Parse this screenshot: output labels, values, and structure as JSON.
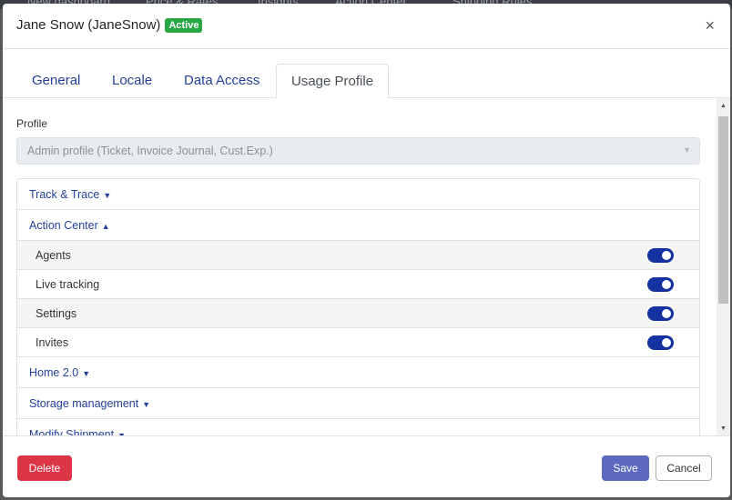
{
  "background_menu": [
    "New dashboard",
    "Price & Rates",
    "Insights",
    "Action Center",
    "Shipping Rules"
  ],
  "modal": {
    "user_name": "Jane Snow (JaneSnow)",
    "status_badge": "Active",
    "close_glyph": "×"
  },
  "tabs": [
    {
      "label": "General",
      "active": false
    },
    {
      "label": "Locale",
      "active": false
    },
    {
      "label": "Data Access",
      "active": false
    },
    {
      "label": "Usage Profile",
      "active": true
    }
  ],
  "profile": {
    "label": "Profile",
    "value": "Admin profile (Ticket, Invoice Journal, Cust.Exp.)",
    "disabled": true
  },
  "sections": {
    "track_trace": {
      "label": "Track & Trace",
      "arrow": "▼"
    },
    "action_center": {
      "label": "Action Center",
      "arrow": "▲"
    },
    "home": {
      "label": "Home 2.0",
      "arrow": "▼"
    },
    "storage": {
      "label": "Storage management",
      "arrow": "▼"
    },
    "modify_shipment": {
      "label": "Modify Shipment",
      "arrow": "▼"
    }
  },
  "action_center_items": [
    {
      "label": "Agents",
      "enabled": true
    },
    {
      "label": "Live tracking",
      "enabled": true
    },
    {
      "label": "Settings",
      "enabled": true
    },
    {
      "label": "Invites",
      "enabled": true
    }
  ],
  "footer": {
    "delete_label": "Delete",
    "save_label": "Save",
    "cancel_label": "Cancel"
  },
  "colors": {
    "active_badge": "#28a745",
    "link_blue": "#24409a",
    "toggle_on": "#1533a0",
    "delete": "#dc3545",
    "save": "#5d69c0"
  },
  "icons": {
    "close": "close-icon",
    "select_caret": "chevron-down-icon",
    "scroll_up": "scroll-up-arrow-icon",
    "scroll_down": "scroll-down-arrow-icon"
  }
}
